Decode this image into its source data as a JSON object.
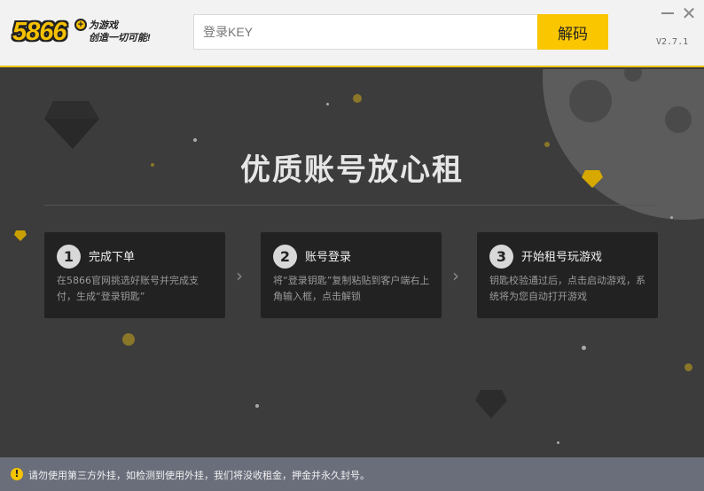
{
  "header": {
    "logo_number": "5866",
    "logo_plus": "+",
    "logo_slogan_line1": "为游戏",
    "logo_slogan_line2": "创造一切可能!",
    "search_placeholder": "登录KEY",
    "decode_label": "解码",
    "minimize_label": "",
    "close_label": "✕",
    "version": "V2.7.1"
  },
  "hero": {
    "title": "优质账号放心租"
  },
  "steps": [
    {
      "number": "1",
      "title": "完成下单",
      "desc": "在5866官网挑选好账号并完成支付，生成“登录钥匙”"
    },
    {
      "number": "2",
      "title": "账号登录",
      "desc": "将“登录钥匙”复制粘贴到客户端右上角输入框，点击解锁"
    },
    {
      "number": "3",
      "title": "开始租号玩游戏",
      "desc": "钥匙校验通过后，点击启动游戏，系统将为您自动打开游戏"
    }
  ],
  "arrows": [
    "›",
    "›"
  ],
  "footer": {
    "warning_icon": "!",
    "text": "请勿使用第三方外挂，如检测到使用外挂，我们将没收租金，押金并永久封号。"
  },
  "colors": {
    "accent": "#f9c600",
    "background": "#3c3c3c",
    "card": "#222222",
    "footer": "#6a6d7a"
  }
}
